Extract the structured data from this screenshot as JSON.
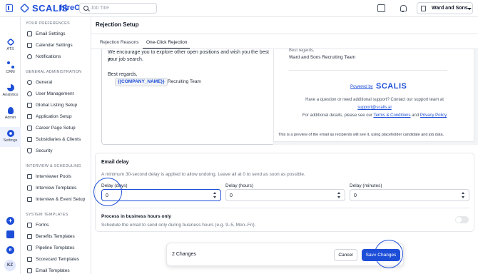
{
  "topbar": {
    "logo_text": "SCALIS",
    "logo_suffix": "hireOS",
    "search_placeholder": "Job Title",
    "company_name": "Ward and Sons"
  },
  "rail": {
    "items": [
      {
        "label": "ATS",
        "icon": "ats-icon"
      },
      {
        "label": "CRM",
        "icon": "crm-icon"
      },
      {
        "label": "Analytics",
        "icon": "analytics-icon"
      },
      {
        "label": "Admin",
        "icon": "admin-icon"
      },
      {
        "label": "Settings",
        "icon": "settings-icon"
      }
    ],
    "avatar_initials": "KZ"
  },
  "settings_nav": {
    "sections": [
      {
        "title": "YOUR PREFERENCES",
        "items": [
          "Email Settings",
          "Calendar Settings",
          "Notifications"
        ]
      },
      {
        "title": "GENERAL ADMINISTRATION",
        "items": [
          "General",
          "User Management",
          "Global Listing Setup",
          "Application Setup",
          "Career Page Setup",
          "Subsidiaries & Clients",
          "Security"
        ]
      },
      {
        "title": "INTERVIEW & SCHEDULING",
        "items": [
          "Interviewer Pools",
          "Interview Templates",
          "Interview & Event Setup"
        ]
      },
      {
        "title": "SYSTEM TEMPLATES",
        "items": [
          "Forms",
          "Benefits Templates",
          "Pipeline Templates",
          "Scorecard Templates",
          "Email Templates"
        ]
      }
    ]
  },
  "main": {
    "title": "Rejection Setup",
    "tabs": [
      "Rejection Reasons",
      "One-Click Rejection"
    ],
    "active_tab": "One-Click Rejection"
  },
  "editor": {
    "line1": "We encourage you to explore other open positions and wish you the best in",
    "line2": "your job search.",
    "regards": "Best regards,",
    "token": "{{COMPANY_NAME}}",
    "token_after": "Recruiting Team"
  },
  "preview": {
    "partial_line": "Best regards,",
    "signature": "Ward and Sons Recruiting Team",
    "powered_by": "Powered by",
    "brand": "SCALIS",
    "help_line": "Have a question or need additional support? Contact our support team at",
    "support_email": "support@scalis.ai",
    "details_prefix": "For additional details, please see our",
    "terms_link": "Terms & Conditions",
    "and_word": "and",
    "privacy_link": "Privacy Policy",
    "note": "This is a preview of the email as recipients will see it, using placeholder candidate and job data."
  },
  "delay": {
    "title": "Email delay",
    "description": "A minimum 30-second delay is applied to allow undoing. Leave all at 0 to send as soon as possible.",
    "fields": [
      {
        "label": "Delay (days)",
        "value": "0"
      },
      {
        "label": "Delay (hours)",
        "value": "0"
      },
      {
        "label": "Delay (minutes)",
        "value": "0"
      }
    ],
    "business_title": "Process in business hours only",
    "business_desc": "Schedule the email to send only during business hours (e.g. 9–5, Mon–Fri).",
    "business_enabled": false
  },
  "savebar": {
    "count": "2 Changes",
    "cancel": "Cancel",
    "save": "Save Changes"
  },
  "colors": {
    "accent": "#1d4ed8",
    "background": "#f3f5f9"
  }
}
